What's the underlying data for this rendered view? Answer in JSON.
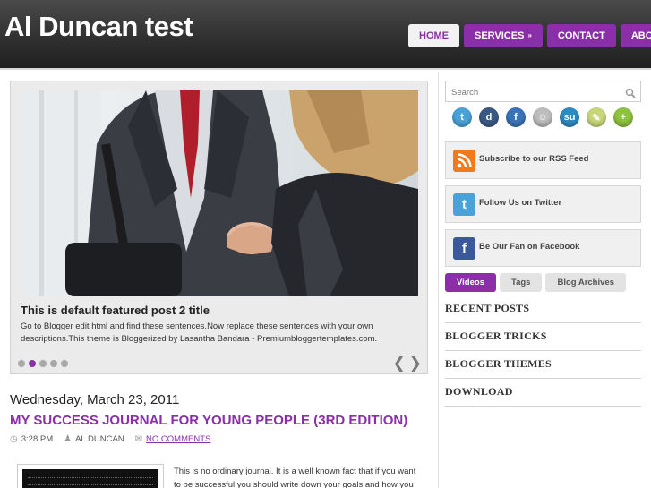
{
  "site": {
    "title": "Al Duncan test"
  },
  "nav": {
    "items": [
      {
        "label": "HOME"
      },
      {
        "label": "SERVICES"
      },
      {
        "label": "CONTACT"
      },
      {
        "label": "ABOUT"
      }
    ],
    "services_caret": "»"
  },
  "slider": {
    "title": "This is default featured post 2 title",
    "description": "Go to Blogger edit html and find these sentences.Now replace these sentences with your own descriptions.This theme is Bloggerized by Lasantha Bandara - Premiumbloggertemplates.com.",
    "dots_count": 5,
    "active_dot": 2,
    "prev_arrow": "❮",
    "next_arrow": "❯"
  },
  "post": {
    "date": "Wednesday, March 23, 2011",
    "title": "MY SUCCESS JOURNAL FOR YOUNG PEOPLE (3RD EDITION)",
    "time": "3:28 PM",
    "author": "AL DUNCAN",
    "comments": "NO COMMENTS",
    "excerpt": "This is no ordinary journal. It is a well known fact that if you want to be successful you should write down your goals and how you plan"
  },
  "sidebar": {
    "search": {
      "placeholder": "Search"
    },
    "social": [
      {
        "icon": "twitter-icon",
        "color": "#4aa3d8",
        "glyph": "t"
      },
      {
        "icon": "digg-icon",
        "color": "#3a5a86",
        "glyph": "d"
      },
      {
        "icon": "facebook-icon",
        "color": "#3b73b9",
        "glyph": "f"
      },
      {
        "icon": "delicious-icon",
        "color": "#bdbdbd",
        "glyph": "☺"
      },
      {
        "icon": "stumbleupon-icon",
        "color": "#2d8bc3",
        "glyph": "su"
      },
      {
        "icon": "technorati-icon",
        "color": "#c9d77a",
        "glyph": "✎"
      },
      {
        "icon": "add-icon",
        "color": "#8fc33f",
        "glyph": "+"
      }
    ],
    "promos": [
      {
        "label": "Subscribe to our RSS Feed",
        "icon": "rss-icon",
        "color": "#f07a1c"
      },
      {
        "label": "Follow Us on Twitter",
        "icon": "twitter-icon",
        "color": "#4aa3d8"
      },
      {
        "label": "Be Our Fan on Facebook",
        "icon": "facebook-icon",
        "color": "#3b5998"
      }
    ],
    "tabs": [
      {
        "label": "Videos"
      },
      {
        "label": "Tags"
      },
      {
        "label": "Blog Archives"
      }
    ],
    "widgets": [
      {
        "title": "RECENT POSTS"
      },
      {
        "title": "BLOGGER TRICKS"
      },
      {
        "title": "BLOGGER THEMES"
      },
      {
        "title": "DOWNLOAD"
      }
    ]
  },
  "colors": {
    "accent": "#8b2fa8",
    "header": "#333333"
  }
}
